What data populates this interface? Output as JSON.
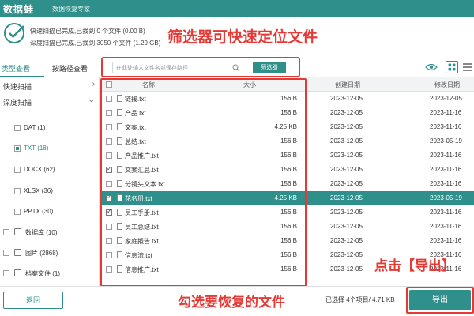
{
  "app": {
    "logo": "数据蛙",
    "subtitle": "数据恢复专家"
  },
  "status": {
    "line1": "快速扫描已完成,已找到 0 个文件 (0.00 B)",
    "line2": "深度扫描已完成,已找到 3050 个文件 (1.29 GB)"
  },
  "annotations": {
    "top": "筛选器可快速定位文件",
    "bottom": "勾选要恢复的文件",
    "right": "点击【导出】"
  },
  "tabs": [
    "类型查看",
    "按路径查看"
  ],
  "search": {
    "placeholder": "在此处输入文件名或保存路径",
    "filter_label": "筛选器"
  },
  "sidebar": {
    "sections": [
      {
        "label": "快速扫描",
        "chevron": "›"
      },
      {
        "label": "深度扫描",
        "chevron": "⌄"
      }
    ],
    "types": [
      {
        "label": "DAT (1)",
        "active": false
      },
      {
        "label": "TXT (18)",
        "active": true
      },
      {
        "label": "DOCX (62)",
        "active": false
      },
      {
        "label": "XLSX (36)",
        "active": false
      },
      {
        "label": "PPTX (30)",
        "active": false
      }
    ],
    "categories": [
      {
        "label": "数据库 (10)"
      },
      {
        "label": "图片 (2868)"
      },
      {
        "label": "档案文件 (1)"
      }
    ]
  },
  "table": {
    "headers": {
      "name": "名称",
      "size": "大小",
      "created": "创建日期",
      "modified": "修改日期"
    },
    "rows": [
      {
        "name": "链接.txt",
        "size": "156 B",
        "created": "2023-12-05",
        "modified": "2023-12-05",
        "checked": false,
        "selected": false
      },
      {
        "name": "产品.txt",
        "size": "156 B",
        "created": "2023-12-05",
        "modified": "2023-11-16",
        "checked": false,
        "selected": false
      },
      {
        "name": "文案.txt",
        "size": "4.25 KB",
        "created": "2023-12-05",
        "modified": "2023-11-16",
        "checked": false,
        "selected": false
      },
      {
        "name": "总结.txt",
        "size": "156 B",
        "created": "2023-12-05",
        "modified": "2023-05-19",
        "checked": false,
        "selected": false
      },
      {
        "name": "产品推广.txt",
        "size": "156 B",
        "created": "2023-12-05",
        "modified": "2023-11-16",
        "checked": false,
        "selected": false
      },
      {
        "name": "文案汇总.txt",
        "size": "156 B",
        "created": "2023-12-05",
        "modified": "2023-11-16",
        "checked": true,
        "selected": false
      },
      {
        "name": "分镜头文本.txt",
        "size": "156 B",
        "created": "2023-12-05",
        "modified": "2023-11-16",
        "checked": false,
        "selected": false
      },
      {
        "name": "花名册.txt",
        "size": "4.25 KB",
        "created": "2023-12-05",
        "modified": "2023-05-19",
        "checked": true,
        "selected": true
      },
      {
        "name": "员工手册.txt",
        "size": "156 B",
        "created": "2023-12-05",
        "modified": "2023-11-16",
        "checked": true,
        "selected": false
      },
      {
        "name": "员工总结.txt",
        "size": "156 B",
        "created": "2023-12-05",
        "modified": "2023-11-16",
        "checked": false,
        "selected": false
      },
      {
        "name": "家庭报告.txt",
        "size": "156 B",
        "created": "2023-12-05",
        "modified": "2023-11-16",
        "checked": false,
        "selected": false
      },
      {
        "name": "信息流.txt",
        "size": "156 B",
        "created": "2023-12-05",
        "modified": "2023-11-16",
        "checked": false,
        "selected": false
      },
      {
        "name": "信息推广.txt",
        "size": "156 B",
        "created": "2023-12-05",
        "modified": "2023-11-16",
        "checked": false,
        "selected": false
      }
    ]
  },
  "bottom": {
    "back_label": "返回",
    "selected_info": "已选择 4个项目/ 4.71 KB",
    "export_label": "导出"
  },
  "colors": {
    "accent": "#2f8f8a",
    "annotation": "#e53935"
  }
}
